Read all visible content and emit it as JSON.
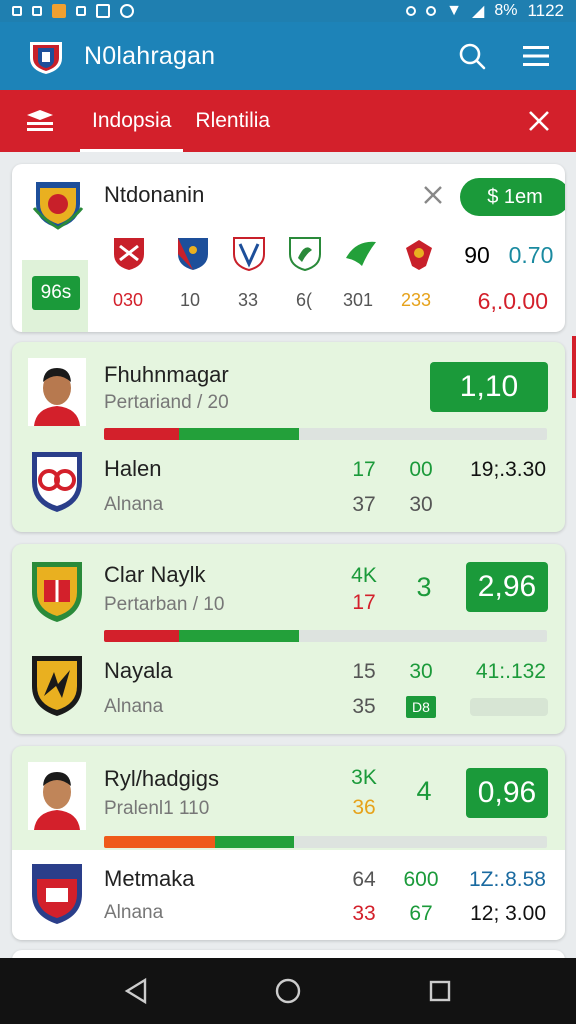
{
  "status_bar": {
    "time": "1122",
    "battery": "8%"
  },
  "app_bar": {
    "title": "N0lahragan"
  },
  "tabs": [
    {
      "label": "Indopsia",
      "active": true
    },
    {
      "label": "Rlentilia",
      "active": false
    }
  ],
  "summary_card": {
    "title": "Ntdonanin",
    "pill": "$ 1em",
    "badge": "96s",
    "numbers": [
      "030",
      "10",
      "33",
      "6(",
      "301",
      "233"
    ],
    "right_top": [
      "90",
      "0.70"
    ],
    "right_bottom": "6,.0.00"
  },
  "matches": [
    {
      "home_name": "Fhuhnmagar",
      "home_sub": "Pertariand / 20",
      "odds": "1,10",
      "bar_red": 0.17,
      "bar_green": 0.27,
      "away_name": "Halen",
      "away_sub": "Alnana",
      "stat_a_top": "17",
      "stat_b_top": "00",
      "right_top": "19;.3.30",
      "stat_a_bottom": "37",
      "stat_b_bottom": "30"
    },
    {
      "home_name": "Clar Naylk",
      "home_sub": "Pertarban / 10",
      "odds": "2,96",
      "stat_a_top": "4K",
      "stat_a_mid": "17",
      "stat_b_top": "3",
      "bar_red": 0.17,
      "bar_green": 0.27,
      "away_name": "Nayala",
      "away_sub": "Alnana",
      "stat_a_bottom_1": "15",
      "stat_b_bottom_1": "30",
      "right_mid": "41:.132",
      "stat_a_bottom_2": "35",
      "mini_badge": "D8"
    },
    {
      "home_name": "Ryl/hadgigs",
      "home_sub": "Pralenl1 110",
      "odds": "0,96",
      "stat_a_top": "3K",
      "stat_a_mid": "36",
      "stat_b_top": "4",
      "bar_red": 0.25,
      "bar_green": 0.18,
      "away_name": "Metmaka",
      "away_sub": "Alnana",
      "stat_a_bottom_1": "64",
      "stat_b_bottom_1": "600",
      "right_bottom_1": "1Z:.8.58",
      "stat_a_bottom_2": "33",
      "stat_b_bottom_2": "67",
      "right_bottom_2": "12; 3.00"
    }
  ],
  "colors": {
    "app_bar": "#1d83b8",
    "red_bar": "#d3202b",
    "accent_green": "#1b9a3a",
    "card_green": "#e5f5df"
  }
}
